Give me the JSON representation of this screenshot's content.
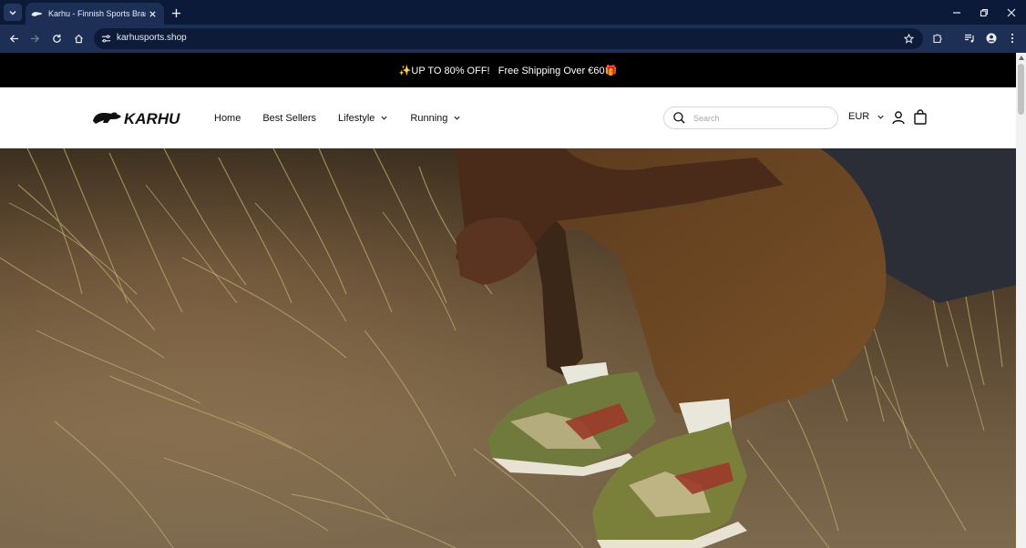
{
  "browser": {
    "tab_title": "Karhu - Finnish Sports Brand - ...",
    "url": "karhusports.shop"
  },
  "announcement": {
    "text": "✨UP TO 80% OFF!   Free Shipping Over €60🎁"
  },
  "header": {
    "logo_text": "KARHU",
    "nav": [
      {
        "label": "Home"
      },
      {
        "label": "Best Sellers"
      },
      {
        "label": "Lifestyle"
      },
      {
        "label": "Running"
      }
    ],
    "search": {
      "placeholder": "Search",
      "value": ""
    },
    "currency": "EUR"
  },
  "hero": {
    "icon": "hero-photo-sneakers-in-dune-grass"
  },
  "colors": {
    "chrome_dark": "#0b1a38",
    "chrome_toolbar": "#1e2f55",
    "announcement_bg": "#000000",
    "header_bg": "#ffffff"
  }
}
